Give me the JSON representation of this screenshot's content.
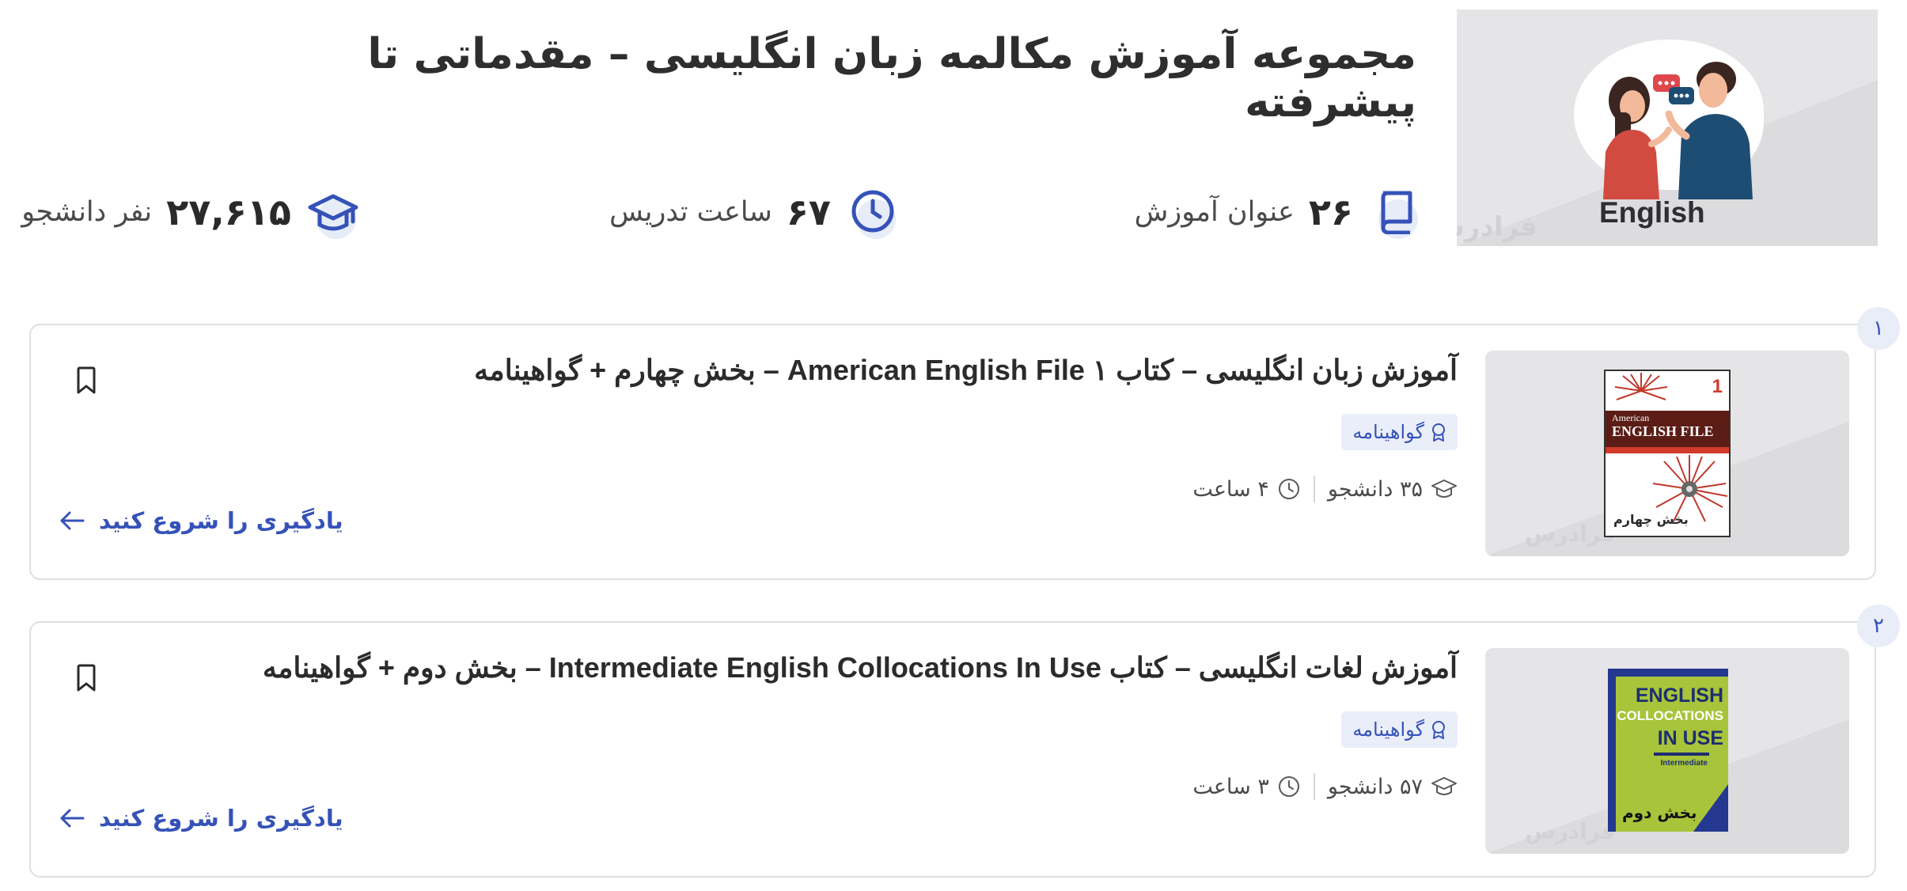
{
  "header": {
    "title": "مجموعه آموزش مکالمه زبان انگلیسی – مقدماتی تا پیشرفته",
    "hero_label": "English",
    "hero_watermark": "فرادرس"
  },
  "stats": [
    {
      "icon": "book-icon",
      "number": "۲۶",
      "label": "عنوان آموزش"
    },
    {
      "icon": "clock-icon",
      "number": "۶۷",
      "label": "ساعت تدریس"
    },
    {
      "icon": "graduation-cap-icon",
      "number": "۲۷,۶۱۵",
      "label": "نفر دانشجو"
    }
  ],
  "courses": [
    {
      "index": "۱",
      "title": "آموزش زبان انگلیسی – کتاب American English File ۱ – بخش چهارم + گواهینامه",
      "certificate": "گواهینامه",
      "students": "۳۵ دانشجو",
      "duration": "۴ ساعت",
      "cta": "یادگیری را شروع کنید",
      "watermark": "فرادرس",
      "cover": {
        "number": "1",
        "line1": "American",
        "line2": "ENGLISH FILE",
        "part": "بخش چهارم"
      }
    },
    {
      "index": "۲",
      "title": "آموزش لغات انگلیسی – کتاب Intermediate English Collocations In Use – بخش دوم + گواهینامه",
      "certificate": "گواهینامه",
      "students": "۵۷ دانشجو",
      "duration": "۳ ساعت",
      "cta": "یادگیری را شروع کنید",
      "watermark": "فرادرس",
      "cover": {
        "line1": "ENGLISH",
        "line2": "COLLOCATIONS",
        "line3": "IN USE",
        "line4": "Intermediate",
        "part": "بخش دوم"
      }
    }
  ],
  "colors": {
    "accent": "#3552b8",
    "accent_bg": "#eaeef9",
    "border": "#dedfe3"
  }
}
